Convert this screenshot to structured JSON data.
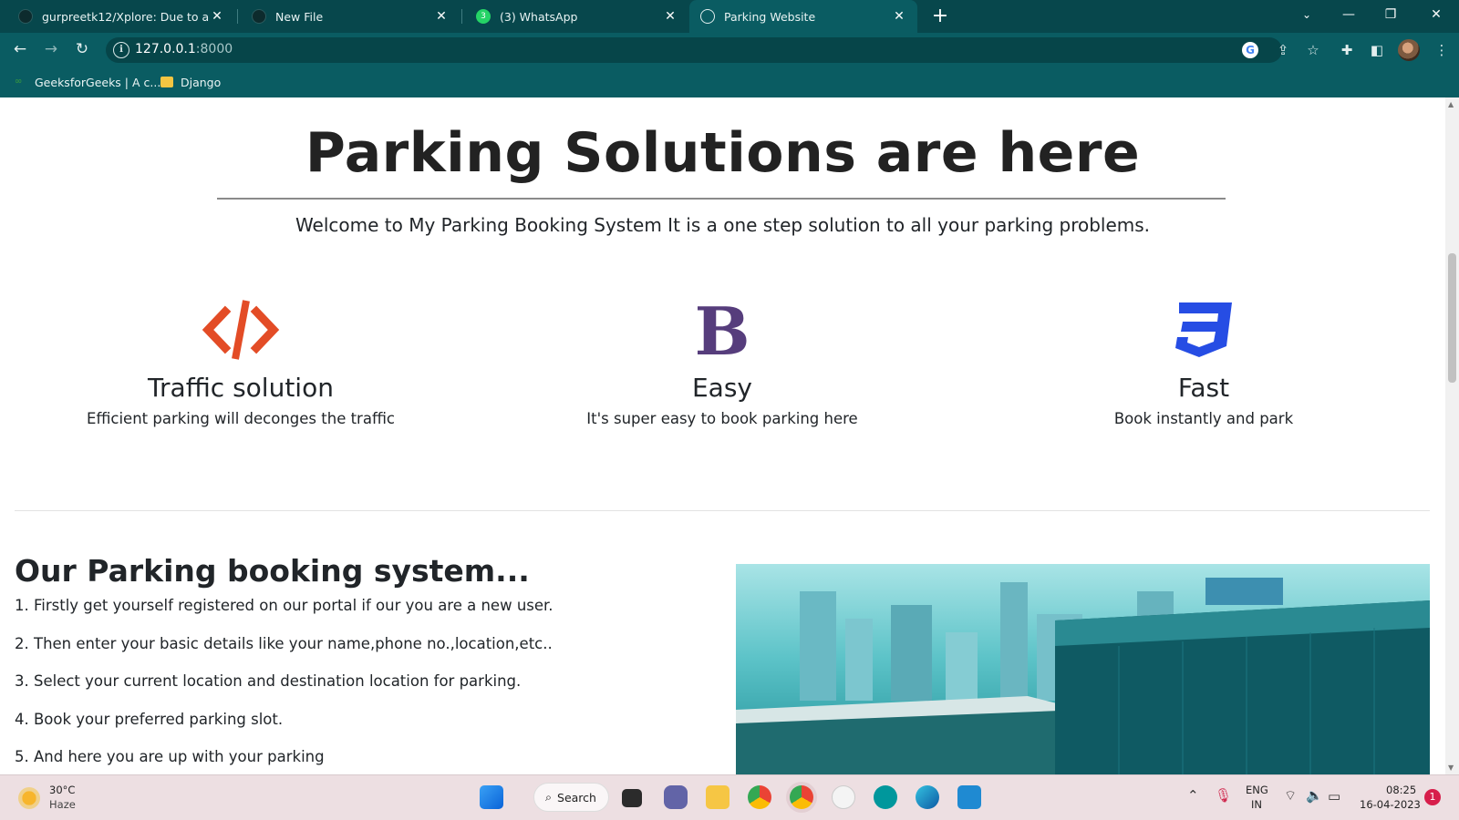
{
  "browser": {
    "tabs": [
      {
        "title": "gurpreetk12/Xplore: Due to a lac",
        "icon": "github-icon"
      },
      {
        "title": "New File",
        "icon": "github-icon"
      },
      {
        "title": "(3) WhatsApp",
        "icon": "whatsapp-icon",
        "badge": "3"
      },
      {
        "title": "Parking Website",
        "icon": "globe-icon",
        "active": true
      }
    ],
    "url_host": "127.0.0.1",
    "url_port": ":8000",
    "bookmarks": [
      {
        "label": "GeeksforGeeks | A c...",
        "icon": "gfg-icon"
      },
      {
        "label": "Django",
        "icon": "folder-icon"
      }
    ],
    "colors": {
      "chrome": "#0a5c62",
      "tabbar": "#07474c"
    }
  },
  "page": {
    "title": "Parking Solutions are here",
    "lead": "Welcome to My Parking Booking System It is a one step solution to all your parking problems.",
    "features": [
      {
        "title": "Traffic solution",
        "description": "Efficient parking will deconges the traffic",
        "icon": "code-icon",
        "color": "#e34c26"
      },
      {
        "title": "Easy",
        "description": "It's super easy to book parking here",
        "icon": "bootstrap-icon",
        "color": "#563d7c"
      },
      {
        "title": "Fast",
        "description": "Book instantly and park",
        "icon": "css3-icon",
        "color": "#264de4"
      }
    ],
    "system_title": "Our Parking booking system...",
    "system_steps": [
      "1. Firstly get yourself registered on our portal if our you are a new user.",
      "2. Then enter your basic details like your name,phone no.,location,etc..",
      "3. Select your current location and destination location for parking.",
      "4. Book your preferred parking slot.",
      "5. And here you are up with your parking"
    ]
  },
  "taskbar": {
    "weather_temp": "30°C",
    "weather_desc": "Haze",
    "search_label": "Search",
    "lang_top": "ENG",
    "lang_bottom": "IN",
    "time": "08:25",
    "date": "16-04-2023",
    "notification_count": "1"
  }
}
